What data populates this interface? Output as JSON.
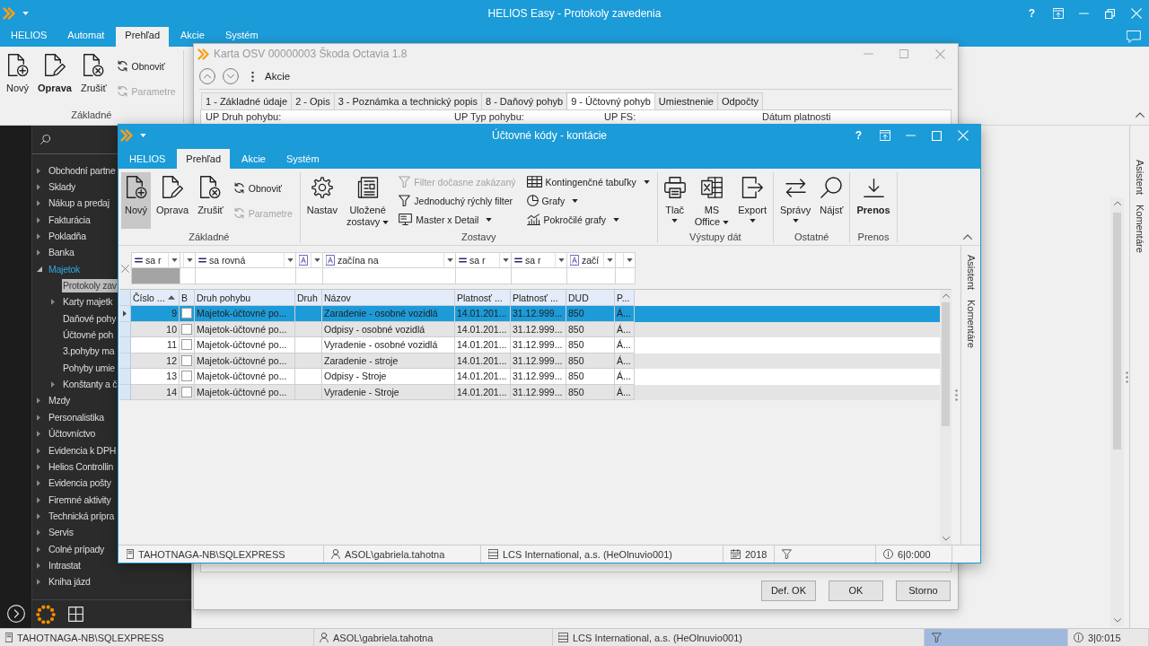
{
  "main_window": {
    "title": "HELIOS Easy - Protokoly zavedenia",
    "help": "?",
    "tabs": [
      {
        "label": "HELIOS",
        "selected": false
      },
      {
        "label": "Automat",
        "selected": false
      },
      {
        "label": "Prehľad",
        "selected": true
      },
      {
        "label": "Akcie",
        "selected": false
      },
      {
        "label": "Systém",
        "selected": false
      }
    ],
    "ribbon": {
      "groups": [
        {
          "label": "Základné",
          "items": [
            {
              "kind": "large",
              "label": "Nový",
              "disabled": false,
              "default": false,
              "hovered": false,
              "dropdown": false
            },
            {
              "kind": "large",
              "label": "Oprava",
              "disabled": false,
              "default": true,
              "hovered": false,
              "dropdown": false
            },
            {
              "kind": "large",
              "label": "Zrušiť",
              "disabled": false,
              "default": false,
              "hovered": false,
              "dropdown": false
            },
            {
              "kind": "small",
              "label": "Obnoviť",
              "disabled": false,
              "default": false,
              "hovered": false,
              "dropdown": false
            },
            {
              "kind": "small",
              "label": "Parametre",
              "disabled": true,
              "default": false,
              "hovered": false,
              "dropdown": false
            }
          ]
        }
      ]
    },
    "navigation": {
      "items": [
        {
          "label": "Obchodní partne",
          "kind": "folder",
          "expanded": false,
          "selected": false
        },
        {
          "label": "Sklady",
          "kind": "folder",
          "expanded": false,
          "selected": false
        },
        {
          "label": "Nákup a predaj",
          "kind": "folder",
          "expanded": false,
          "selected": false
        },
        {
          "label": "Fakturácia",
          "kind": "folder",
          "expanded": false,
          "selected": false
        },
        {
          "label": "Pokladňa",
          "kind": "folder",
          "expanded": false,
          "selected": false
        },
        {
          "label": "Banka",
          "kind": "folder",
          "expanded": false,
          "selected": false
        },
        {
          "label": "Majetok",
          "kind": "folder",
          "expanded": true,
          "selected": false,
          "children": [
            {
              "label": "Protokoly zav",
              "kind": "leaf",
              "selected": true
            },
            {
              "label": "Karty majetk",
              "kind": "folder",
              "expanded": false,
              "selected": false
            },
            {
              "label": "Daňové pohy",
              "kind": "leaf",
              "selected": false
            },
            {
              "label": "Účtovné poh",
              "kind": "leaf",
              "selected": false
            },
            {
              "label": "3.pohyby ma",
              "kind": "leaf",
              "selected": false
            },
            {
              "label": "Pohyby umie",
              "kind": "leaf",
              "selected": false
            },
            {
              "label": "Konštanty a č",
              "kind": "folder",
              "expanded": false,
              "selected": false
            }
          ]
        },
        {
          "label": "Mzdy",
          "kind": "folder",
          "expanded": false,
          "selected": false
        },
        {
          "label": "Personalistika",
          "kind": "folder",
          "expanded": false,
          "selected": false
        },
        {
          "label": "Účtovníctvo",
          "kind": "folder",
          "expanded": false,
          "selected": false
        },
        {
          "label": "Evidencia k DPH",
          "kind": "folder",
          "expanded": false,
          "selected": false
        },
        {
          "label": "Helios Controllin",
          "kind": "folder",
          "expanded": false,
          "selected": false
        },
        {
          "label": "Evidencia pošty",
          "kind": "folder",
          "expanded": false,
          "selected": false
        },
        {
          "label": "Firemné aktivity",
          "kind": "folder",
          "expanded": false,
          "selected": false
        },
        {
          "label": "Technická prípra",
          "kind": "folder",
          "expanded": false,
          "selected": false
        },
        {
          "label": "Servis",
          "kind": "folder",
          "expanded": false,
          "selected": false
        },
        {
          "label": "Colné prípady",
          "kind": "folder",
          "expanded": false,
          "selected": false
        },
        {
          "label": "Intrastat",
          "kind": "folder",
          "expanded": false,
          "selected": false
        },
        {
          "label": "Kniha jázd",
          "kind": "folder",
          "expanded": false,
          "selected": false
        }
      ]
    },
    "side_tabs": [
      "Asistent",
      "Komentáre"
    ],
    "status_bar": {
      "server": "TAHOTNAGA-NB\\SQLEXPRESS",
      "user": "ASOL\\gabriela.tahotna",
      "company": "LCS International, a.s. (HeOlnuvio001)",
      "filter": {
        "active": true
      },
      "info": "3|0:015"
    }
  },
  "record_window": {
    "title": "Karta OSV 00000003 Škoda Octavia 1.8",
    "actions_label": "Akcie",
    "tabs": [
      {
        "label": "1 - Základné údaje",
        "selected": false
      },
      {
        "label": "2 - Opis",
        "selected": false
      },
      {
        "label": "3 - Poznámka a technický popis",
        "selected": false
      },
      {
        "label": "8 - Daňový pohyb",
        "selected": false
      },
      {
        "label": "9 - Účtovný pohyb",
        "selected": true
      },
      {
        "label": "Umiestnenie",
        "selected": false
      },
      {
        "label": "Odpočty",
        "selected": false
      }
    ],
    "columns": [
      "UP Druh pohybu:",
      "UP Typ pohybu:",
      "UP FS:",
      "Dátum platnosti"
    ],
    "buttons": [
      "Def. OK",
      "OK",
      "Storno"
    ]
  },
  "dialog": {
    "title": "Účtovné kódy - kontácie",
    "help": "?",
    "tabs": [
      {
        "label": "HELIOS",
        "selected": false
      },
      {
        "label": "Prehľad",
        "selected": true
      },
      {
        "label": "Akcie",
        "selected": false
      },
      {
        "label": "Systém",
        "selected": false
      }
    ],
    "ribbon": {
      "groups": [
        {
          "label": "Základné",
          "items": [
            {
              "kind": "large",
              "label": "Nový",
              "disabled": false,
              "default": false,
              "hovered": true,
              "dropdown": false
            },
            {
              "kind": "large",
              "label": "Oprava",
              "disabled": false,
              "default": false,
              "hovered": false,
              "dropdown": false
            },
            {
              "kind": "large",
              "label": "Zrušiť",
              "disabled": false,
              "default": false,
              "hovered": false,
              "dropdown": false
            },
            {
              "kind": "small",
              "label": "Obnoviť",
              "disabled": false,
              "default": false,
              "hovered": false,
              "dropdown": false
            },
            {
              "kind": "small",
              "label": "Parametre",
              "disabled": true,
              "default": false,
              "hovered": false,
              "dropdown": false
            }
          ]
        },
        {
          "label": "Zostavy",
          "items": [
            {
              "kind": "large",
              "label": "Nastav",
              "disabled": false,
              "default": false,
              "hovered": false,
              "dropdown": false
            },
            {
              "kind": "large",
              "label": "Uložené zostavy",
              "disabled": false,
              "default": false,
              "hovered": false,
              "dropdown": true
            },
            {
              "kind": "small",
              "label": "Filter dočasne zakázaný",
              "disabled": true,
              "default": false,
              "hovered": false,
              "dropdown": false
            },
            {
              "kind": "small",
              "label": "Jednoduchý rýchly filter",
              "disabled": false,
              "default": false,
              "hovered": false,
              "dropdown": false
            },
            {
              "kind": "small",
              "label": "Master x Detail",
              "disabled": false,
              "default": false,
              "hovered": false,
              "dropdown": true
            },
            {
              "kind": "small",
              "label": "Kontingenčné tabuľky",
              "disabled": false,
              "default": false,
              "hovered": false,
              "dropdown": true
            },
            {
              "kind": "small",
              "label": "Grafy",
              "disabled": false,
              "default": false,
              "hovered": false,
              "dropdown": true
            },
            {
              "kind": "small",
              "label": "Pokročilé grafy",
              "disabled": false,
              "default": false,
              "hovered": false,
              "dropdown": true
            }
          ]
        },
        {
          "label": "Výstupy dát",
          "items": [
            {
              "kind": "large",
              "label": "Tlač",
              "disabled": false,
              "default": false,
              "hovered": false,
              "dropdown": true
            },
            {
              "kind": "large",
              "label": "MS Office",
              "disabled": false,
              "default": false,
              "hovered": false,
              "dropdown": true
            },
            {
              "kind": "large",
              "label": "Export",
              "disabled": false,
              "default": false,
              "hovered": false,
              "dropdown": true
            }
          ]
        },
        {
          "label": "Ostatné",
          "items": [
            {
              "kind": "large",
              "label": "Správy",
              "disabled": false,
              "default": false,
              "hovered": false,
              "dropdown": true
            },
            {
              "kind": "large",
              "label": "Nájsť",
              "disabled": false,
              "default": false,
              "hovered": false,
              "dropdown": false
            }
          ]
        },
        {
          "label": "Prenos",
          "items": [
            {
              "kind": "large",
              "label": "Prenos",
              "disabled": false,
              "default": true,
              "hovered": false,
              "dropdown": false
            }
          ]
        }
      ]
    },
    "filter_row": [
      {
        "kind": "number",
        "operator": "sa r",
        "focused": true
      },
      {
        "kind": "plain",
        "focused": false
      },
      {
        "kind": "number",
        "operator": "sa rovná",
        "focused": false
      },
      {
        "kind": "text",
        "focused": false
      },
      {
        "kind": "text",
        "operator": "začína na",
        "focused": false
      },
      {
        "kind": "number",
        "operator": "sa r",
        "focused": false
      },
      {
        "kind": "number",
        "operator": "sa r",
        "focused": false
      },
      {
        "kind": "text",
        "operator": "začí",
        "focused": false
      },
      {
        "kind": "plain",
        "focused": false
      }
    ],
    "table": {
      "columns": [
        {
          "label": "Číslo ...",
          "sorted": true
        },
        {
          "label": "B",
          "sorted": false
        },
        {
          "label": "Druh pohybu",
          "sorted": false
        },
        {
          "label": "Druh",
          "sorted": false
        },
        {
          "label": "Názov",
          "sorted": false
        },
        {
          "label": "Platnosť ...",
          "sorted": false
        },
        {
          "label": "Platnosť ...",
          "sorted": false
        },
        {
          "label": "DUD",
          "sorted": false
        },
        {
          "label": "P...",
          "sorted": false
        }
      ],
      "rows": [
        {
          "selected": true,
          "number": "9",
          "checked": false,
          "movement": "Majetok-účtovné po...",
          "name": "Zaradenie - osobné vozidlá",
          "valid_from": "14.01.201...",
          "valid_to": "31.12.999...",
          "dud": "850",
          "column_p": "Á..."
        },
        {
          "selected": false,
          "number": "10",
          "checked": false,
          "movement": "Majetok-účtovné po...",
          "name": "Odpisy - osobné vozidlá",
          "valid_from": "14.01.201...",
          "valid_to": "31.12.999...",
          "dud": "850",
          "column_p": "Á..."
        },
        {
          "selected": false,
          "number": "11",
          "checked": false,
          "movement": "Majetok-účtovné po...",
          "name": "Vyradenie - osobné vozidlá",
          "valid_from": "14.01.201...",
          "valid_to": "31.12.999...",
          "dud": "850",
          "column_p": "Á..."
        },
        {
          "selected": false,
          "number": "12",
          "checked": false,
          "movement": "Majetok-účtovné po...",
          "name": "Zaradenie - stroje",
          "valid_from": "14.01.201...",
          "valid_to": "31.12.999...",
          "dud": "850",
          "column_p": "Á..."
        },
        {
          "selected": false,
          "number": "13",
          "checked": false,
          "movement": "Majetok-účtovné po...",
          "name": "Odpisy - Stroje",
          "valid_from": "14.01.201...",
          "valid_to": "31.12.999...",
          "dud": "850",
          "column_p": "Á..."
        },
        {
          "selected": false,
          "number": "14",
          "checked": false,
          "movement": "Majetok-účtovné po...",
          "name": "Vyradenie - Stroje",
          "valid_from": "14.01.201...",
          "valid_to": "31.12.999...",
          "dud": "850",
          "column_p": "Á..."
        }
      ]
    },
    "side_tabs": [
      "Asistent",
      "Komentáre"
    ],
    "status_bar": {
      "server": "TAHOTNAGA-NB\\SQLEXPRESS",
      "user": "ASOL\\gabriela.tahotna",
      "company": "LCS International, a.s. (HeOlnuvio001)",
      "year": "2018",
      "filter": {
        "active": false
      },
      "info": "6|0:000"
    }
  }
}
